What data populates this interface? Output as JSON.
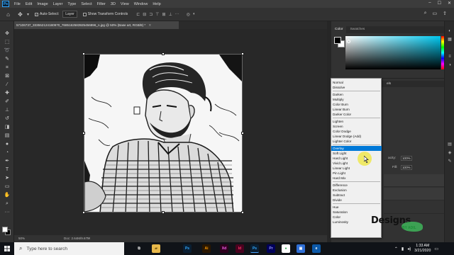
{
  "app": {
    "logo_text": "Ps",
    "menu": [
      "File",
      "Edit",
      "Image",
      "Layer",
      "Type",
      "Select",
      "Filter",
      "3D",
      "View",
      "Window",
      "Help"
    ],
    "window_controls": [
      "–",
      "☐",
      "✕"
    ]
  },
  "options_bar": {
    "auto_select_label": "Auto-Select:",
    "auto_select_checked": true,
    "target_value": "Layer",
    "show_transform_label": "Show Transform Controls"
  },
  "document": {
    "tab_title": "57106737_333552124180970_7685162583925456896_n.jpg @ 50% (Base art, RGB/8) *",
    "close_glyph": "✕"
  },
  "status": {
    "zoom": "50%",
    "doc_size": "Doc: 2.64M/9.67M",
    "arrow": ">"
  },
  "panels": {
    "color_tab": "Color",
    "swatches_tab": "Swatches",
    "layers_tab_partial": "els",
    "opacity_label": "acity:",
    "opacity_value": "100%",
    "fill_label": "Fill:",
    "fill_value": "100%",
    "accent": "#00c8f0"
  },
  "blend_modes": {
    "groups": [
      [
        "Normal",
        "Dissolve"
      ],
      [
        "Darken",
        "Multiply",
        "Color Burn",
        "Linear Burn",
        "Darker Color"
      ],
      [
        "Lighten",
        "Screen",
        "Color Dodge",
        "Linear Dodge (Add)",
        "Lighter Color"
      ],
      [
        "Overlay",
        "Soft Light",
        "Hard Light",
        "Vivid Light",
        "Linear Light",
        "Pin Light",
        "Hard Mix"
      ],
      [
        "Difference",
        "Exclusion",
        "Subtract",
        "Divide"
      ],
      [
        "Hue",
        "Saturation",
        "Color",
        "Luminosity"
      ]
    ],
    "selected": "Overlay",
    "selected_color": "#0078d7"
  },
  "watermark": {
    "title": "Designs",
    "subtitle": "BY ADIL"
  },
  "taskbar": {
    "search_placeholder": "Type here to search",
    "apps": [
      {
        "icon": "task-view-icon",
        "label": "⧉",
        "bg": "#101318",
        "fg": "#ddd"
      },
      {
        "icon": "file-explorer-icon",
        "label": "▰",
        "bg": "#e8b84a",
        "fg": "#7a5a10"
      },
      {
        "icon": "photoshop-icon",
        "label": "Ps",
        "bg": "#0a1f33",
        "fg": "#31a8ff"
      },
      {
        "icon": "illustrator-icon",
        "label": "Ai",
        "bg": "#2b1700",
        "fg": "#ff9a00"
      },
      {
        "icon": "xd-icon",
        "label": "Xd",
        "bg": "#2e001e",
        "fg": "#ff61f6"
      },
      {
        "icon": "indesign-icon",
        "label": "Id",
        "bg": "#49021f",
        "fg": "#ff3366"
      },
      {
        "icon": "photoshop-active-icon",
        "label": "Ps",
        "bg": "#0a1f33",
        "fg": "#31a8ff"
      },
      {
        "icon": "premiere-icon",
        "label": "Pr",
        "bg": "#00005b",
        "fg": "#9999ff"
      },
      {
        "icon": "chrome-icon",
        "label": "●",
        "bg": "#fff",
        "fg": "#34a853"
      },
      {
        "icon": "app-icon",
        "label": "▣",
        "bg": "#2f6fd6",
        "fg": "#fff"
      },
      {
        "icon": "edge-icon",
        "label": "e",
        "bg": "#0c59a8",
        "fg": "#fff"
      }
    ],
    "time": "1:33 AM",
    "date": "3/21/2020"
  }
}
